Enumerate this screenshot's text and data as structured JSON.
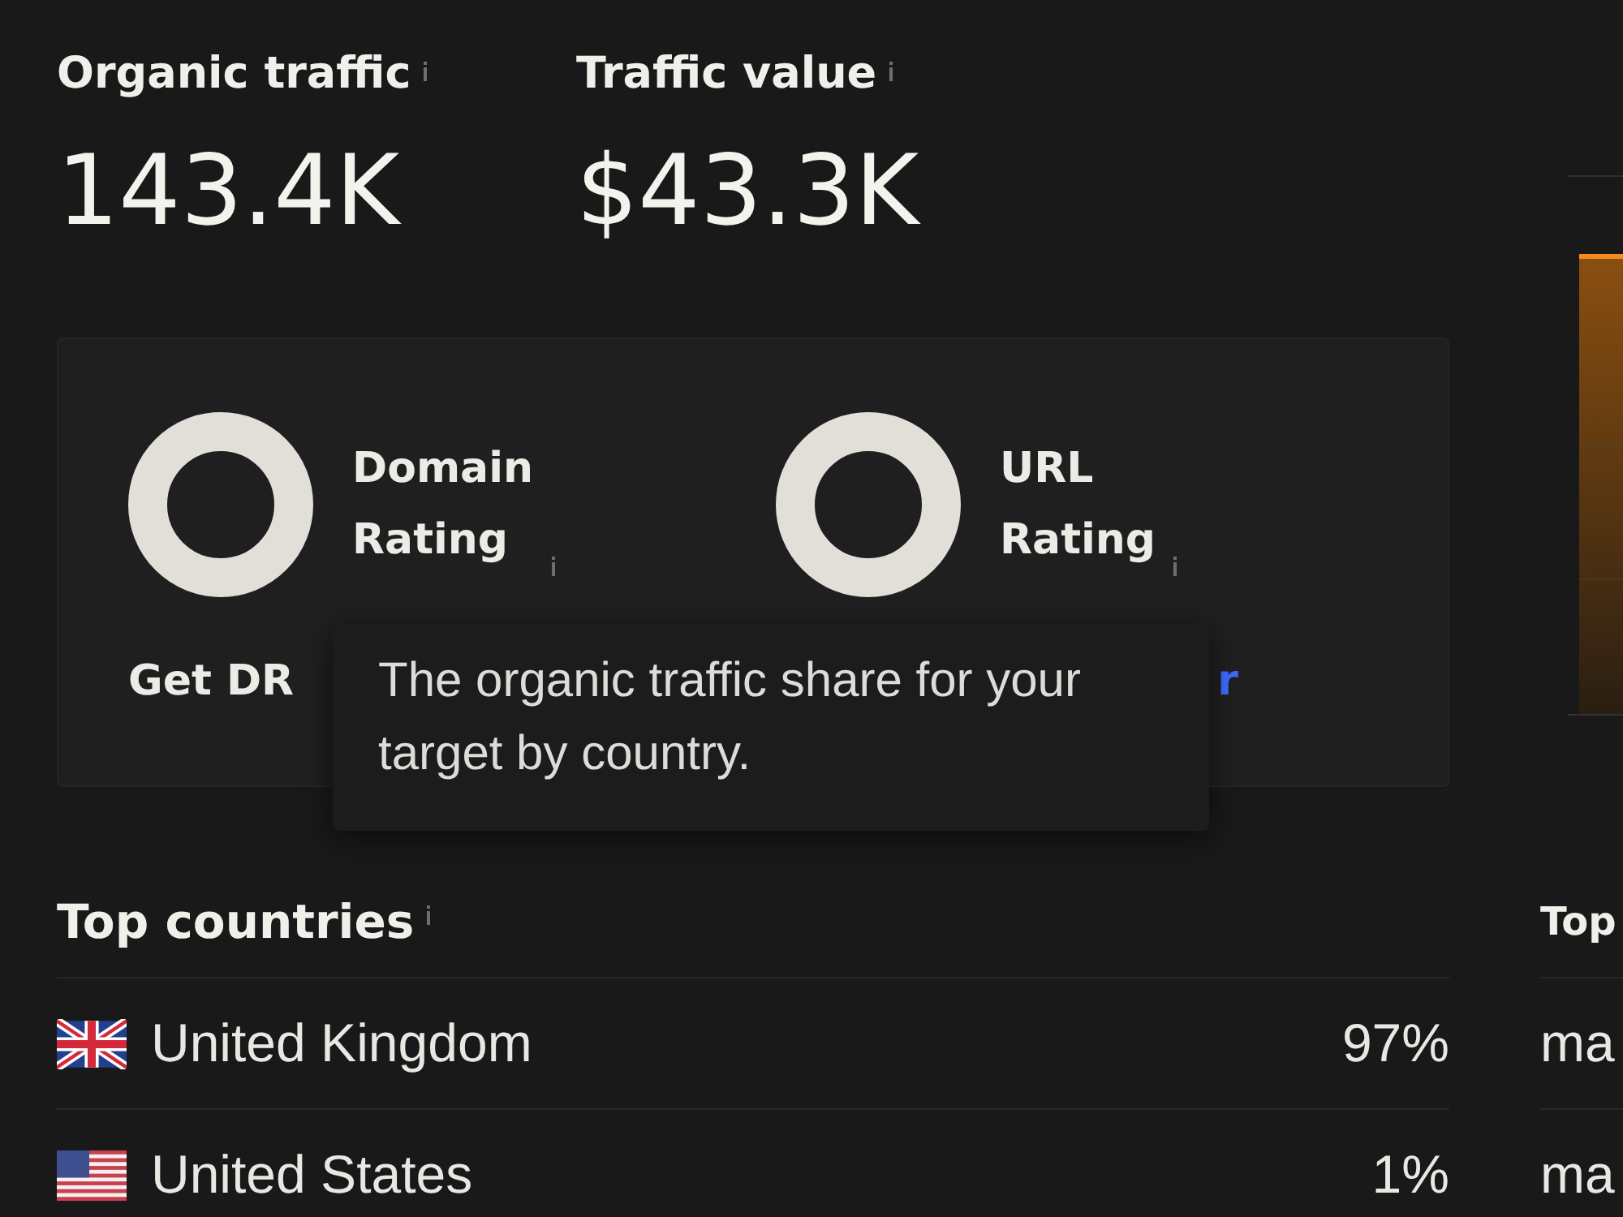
{
  "metrics": [
    {
      "label": "Organic traffic",
      "value": "143.4K"
    },
    {
      "label": "Traffic value",
      "value": "$43.3K"
    }
  ],
  "rating_card": {
    "ratings": [
      {
        "label": "Domain Rating"
      },
      {
        "label": "URL Rating"
      }
    ],
    "note": "Get DR",
    "link": "r"
  },
  "tooltip": {
    "text": "The organic traffic share for your target by country."
  },
  "top_countries": {
    "title": "Top countries",
    "rows": [
      {
        "kind": "gb",
        "name": "United Kingdom",
        "share": "97%"
      },
      {
        "kind": "us",
        "name": "United States",
        "share": "1%"
      }
    ]
  },
  "column_2_section": {
    "title": "Top",
    "rows": [
      {
        "text": "ma"
      },
      {
        "text": "ma"
      }
    ]
  }
}
